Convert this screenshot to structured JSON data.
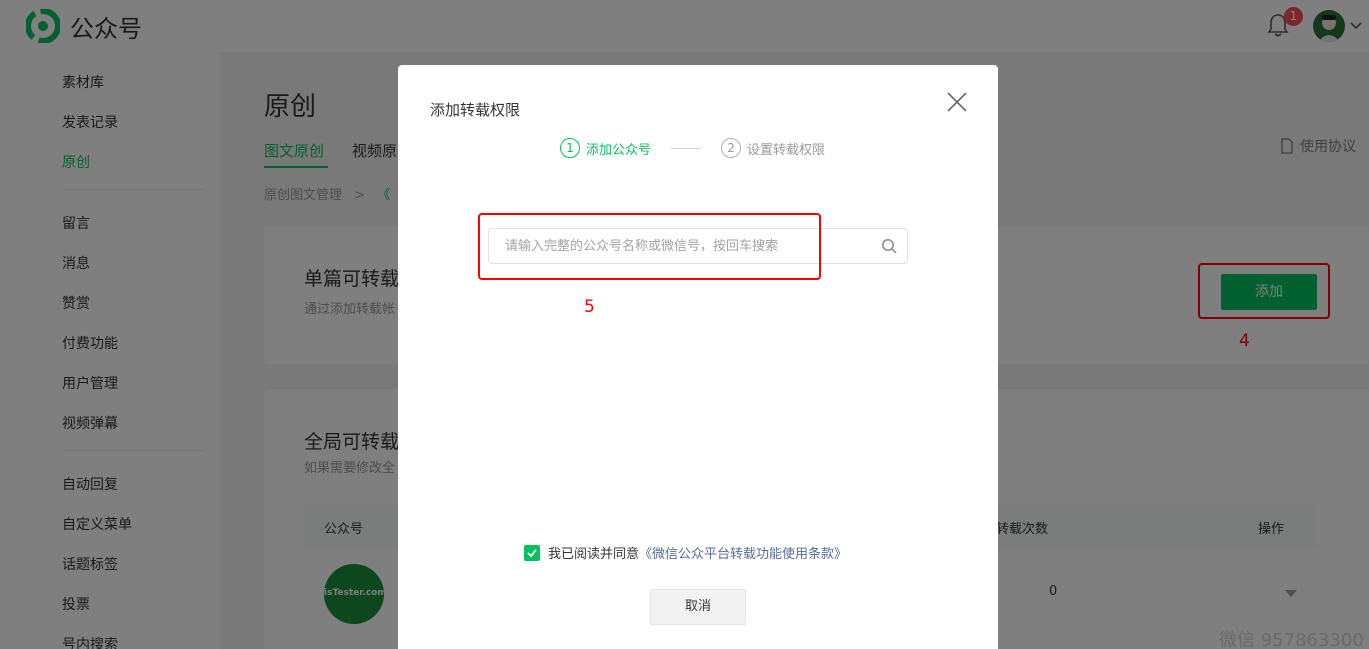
{
  "brand": {
    "name": "公众号",
    "accent_color": "#07c160",
    "logo_icon": "wechat-mp-logo-icon"
  },
  "notifications": {
    "count": "1",
    "icon": "bell-icon"
  },
  "sidebar": {
    "items": [
      {
        "label": "素材库",
        "active": false
      },
      {
        "label": "发表记录",
        "active": false
      },
      {
        "label": "原创",
        "active": true
      },
      {
        "label": "留言",
        "active": false
      },
      {
        "label": "消息",
        "active": false
      },
      {
        "label": "赞赏",
        "active": false
      },
      {
        "label": "付费功能",
        "active": false
      },
      {
        "label": "用户管理",
        "active": false
      },
      {
        "label": "视频弹幕",
        "active": false
      },
      {
        "label": "自动回复",
        "active": false
      },
      {
        "label": "自定义菜单",
        "active": false
      },
      {
        "label": "话题标签",
        "active": false
      },
      {
        "label": "投票",
        "active": false
      },
      {
        "label": "号内搜索",
        "active": false
      }
    ]
  },
  "main": {
    "title": "原创",
    "tabs": [
      {
        "label": "图文原创",
        "active": true
      },
      {
        "label": "视频原",
        "active": false
      }
    ],
    "protocol_link": "使用协议",
    "breadcrumb": {
      "parent": "原创图文管理",
      "separator": ">",
      "current": "《"
    },
    "single_panel": {
      "title": "单篇可转载",
      "desc": "通过添加转载帐",
      "add_button": "添加"
    },
    "global_panel": {
      "title": "全局可转载",
      "desc": "如果需要修改全"
    },
    "table": {
      "headers": [
        "公众号",
        "转载次数",
        "操作"
      ],
      "rows": [
        {
          "avatar_text": "isTester.com",
          "count": "0"
        }
      ]
    }
  },
  "annotations": {
    "label_5": "5",
    "label_4": "4",
    "color": "#ff0000"
  },
  "modal": {
    "title": "添加转载权限",
    "steps": [
      {
        "num": "1",
        "label": "添加公众号",
        "active": true
      },
      {
        "num": "2",
        "label": "设置转载权限",
        "active": false
      }
    ],
    "search": {
      "placeholder": "请输入完整的公众号名称或微信号，按回车搜索",
      "value": ""
    },
    "agreement": {
      "checked": true,
      "prefix": "我已阅读并同意",
      "link": "《微信公众平台转载功能使用条款》"
    },
    "cancel_button": "取消"
  },
  "watermark": "微信 957863300"
}
